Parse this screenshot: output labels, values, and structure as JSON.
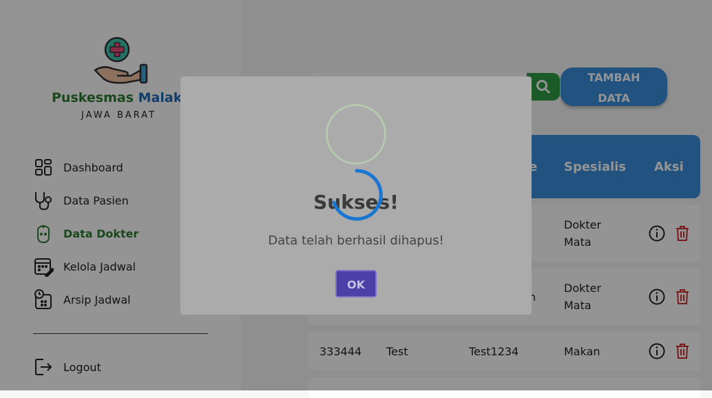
{
  "sidebar": {
    "brand_part1": "Puskesmas",
    "brand_part2": "Malak",
    "region": "JAWA BARAT",
    "items": [
      {
        "label": "Dashboard",
        "icon": "dashboard-grid-icon"
      },
      {
        "label": "Data Pasien",
        "icon": "stethoscope-icon"
      },
      {
        "label": "Data Dokter",
        "icon": "doctor-icon"
      },
      {
        "label": "Kelola Jadwal",
        "icon": "calendar-edit-icon"
      },
      {
        "label": "Arsip Jadwal",
        "icon": "clock-calendar-icon"
      }
    ],
    "logout": "Logout"
  },
  "toolbar": {
    "search_placeholder": "",
    "add_label": "TAMBAH DATA"
  },
  "table": {
    "headers": [
      "e",
      "Spesialis",
      "Aksi"
    ],
    "rows": [
      {
        "id": "",
        "name": "",
        "code": "",
        "specialist": "Dokter Mata"
      },
      {
        "id": "",
        "name": "",
        "code": "h",
        "specialist": "Dokter Mata"
      },
      {
        "id": "333444",
        "name": "Test",
        "code": "Test1234",
        "specialist": "Makan"
      }
    ]
  },
  "modal": {
    "title": "Sukses!",
    "message": "Data telah berhasil dihapus!",
    "ok_label": "OK"
  },
  "colors": {
    "brand_green": "#2e7d32",
    "brand_blue": "#1e6bb8",
    "primary_blue": "#3b8fdd",
    "search_green": "#2e9e44",
    "delete_red": "#d32f2f",
    "ok_button": "#4c3fa8"
  }
}
